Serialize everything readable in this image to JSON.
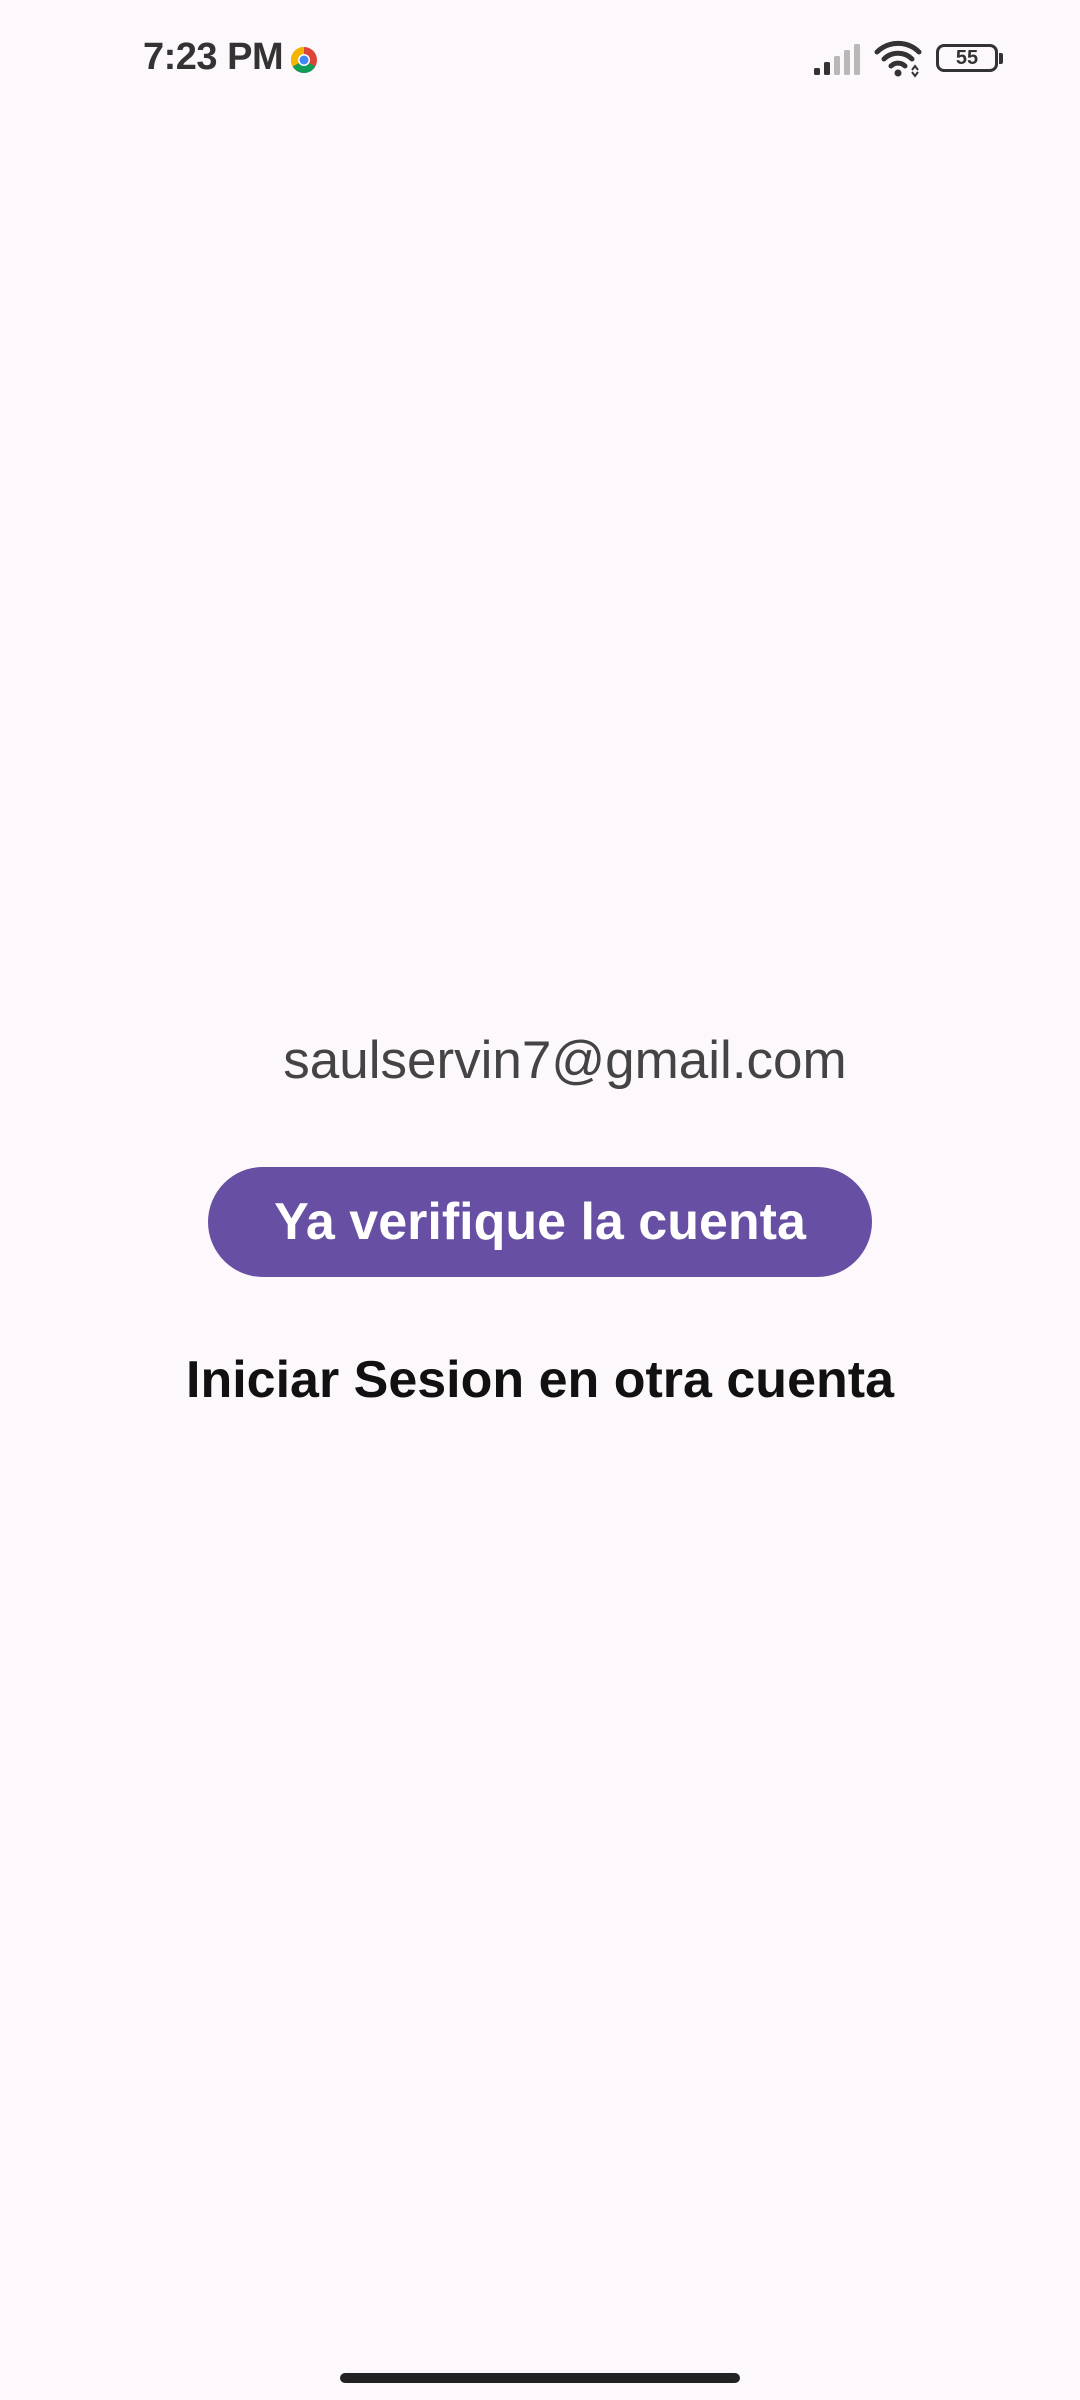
{
  "status_bar": {
    "time": "7:23 PM",
    "battery_level": "55",
    "icons": [
      "chrome-icon",
      "signal-icon",
      "wifi-icon",
      "battery-icon"
    ]
  },
  "account": {
    "email": "saulservin7@gmail.com"
  },
  "actions": {
    "verify_label": "Ya verifique la cuenta",
    "other_account_label": "Iniciar Sesion en otra cuenta"
  },
  "colors": {
    "background": "#fdf8fc",
    "primary": "#6750a4",
    "text": "#111111",
    "email_text": "#444444"
  }
}
